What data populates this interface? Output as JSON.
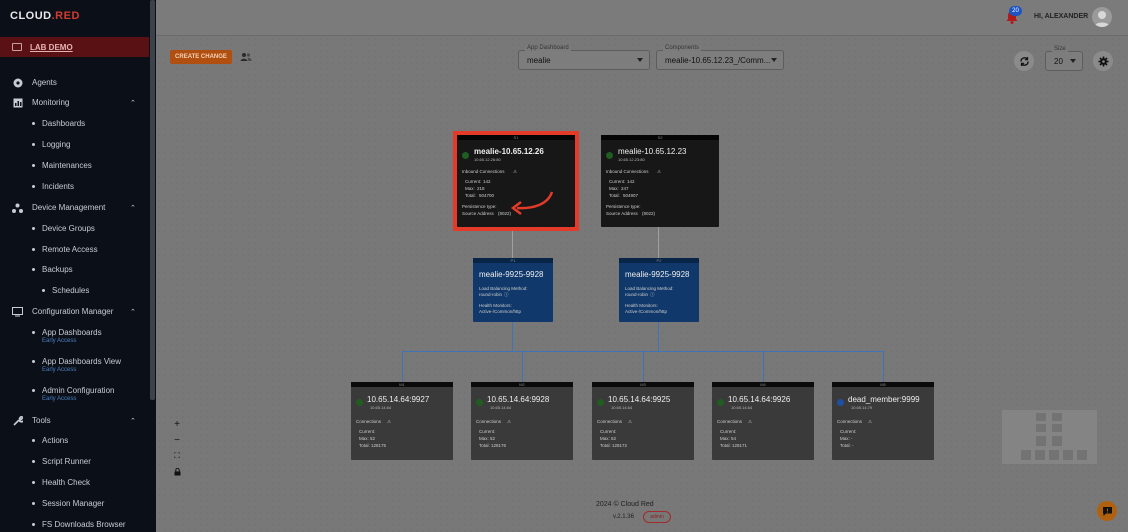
{
  "sidebar": {
    "logo_main": "CLOUD",
    "logo_accent": ".RED",
    "lab": "LAB DEMO",
    "items": [
      {
        "label": "Agents"
      },
      {
        "label": "Monitoring"
      },
      {
        "label": "Dashboards"
      },
      {
        "label": "Logging"
      },
      {
        "label": "Maintenances"
      },
      {
        "label": "Incidents"
      },
      {
        "label": "Device Management"
      },
      {
        "label": "Device Groups"
      },
      {
        "label": "Remote Access"
      },
      {
        "label": "Backups"
      },
      {
        "label": "Schedules"
      },
      {
        "label": "Configuration Manager"
      },
      {
        "label": "App Dashboards"
      },
      {
        "label": "App Dashboards View"
      },
      {
        "label": "Admin Configuration"
      },
      {
        "label": "Tools"
      },
      {
        "label": "Actions"
      },
      {
        "label": "Script Runner"
      },
      {
        "label": "Health Check"
      },
      {
        "label": "Session Manager"
      },
      {
        "label": "FS Downloads Browser"
      }
    ],
    "early_access": "Early Access"
  },
  "header": {
    "notifications": "20",
    "greeting": "HI, ALEXANDER"
  },
  "toolbar": {
    "create_change": "CREATE CHANGE",
    "app_dashboard_label": "App Dashboard",
    "app_dashboard_value": "mealie",
    "components_label": "Components",
    "components_value": "mealie-10.65.12.23_/Comm...",
    "size_label": "Size",
    "size_value": "20"
  },
  "nodes": {
    "top1": {
      "head": "S1",
      "title": "mealie-10.65.12.26",
      "sub": "10.65.12.26:80",
      "inbound": "Inbound Connections",
      "current_label": "Current:",
      "current_val": "142",
      "max_label": "Max:",
      "max_val": "218",
      "total_label": "Total:",
      "total_val": "504700",
      "persistence": "Persistence type:",
      "source": "Source Address",
      "source_link": "(9022)"
    },
    "top2": {
      "head": "S2",
      "title": "mealie-10.65.12.23",
      "sub": "10.65.12.23:80",
      "inbound": "Inbound Connections",
      "current_label": "Current:",
      "current_val": "142",
      "max_label": "Max:",
      "max_val": "247",
      "total_label": "Total:",
      "total_val": "504907",
      "persistence": "Persistence type:",
      "source": "Source Address",
      "source_link": "(9022)"
    },
    "mid1": {
      "head": "P1",
      "title": "mealie-9925-9928",
      "lb": "Load Balancing Method:",
      "lb_val": "round-robin",
      "hm": "Health Monitors:",
      "hm_val": "Active-/Common/http"
    },
    "mid2": {
      "head": "P2",
      "title": "mealie-9925-9928",
      "lb": "Load Balancing Method:",
      "lb_val": "round-robin",
      "hm": "Health Monitors:",
      "hm_val": "Active-/Common/http"
    },
    "members": [
      {
        "head": "M1",
        "title": "10.65.14.64:9927",
        "sub": "10.65.14.64",
        "conn": "Connections",
        "cur": "Current:",
        "max": "Max:  52",
        "total": "Total:  128175"
      },
      {
        "head": "M2",
        "title": "10.65.14.64:9928",
        "sub": "10.65.14.64",
        "conn": "Connections",
        "cur": "Current:",
        "max": "Max:  52",
        "total": "Total:  128176"
      },
      {
        "head": "M3",
        "title": "10.65.14.64:9925",
        "sub": "10.65.14.64",
        "conn": "Connections",
        "cur": "Current:",
        "max": "Max:  52",
        "total": "Total:  128172"
      },
      {
        "head": "M4",
        "title": "10.65.14.64:9926",
        "sub": "10.65.14.64",
        "conn": "Connections",
        "cur": "Current:",
        "max": "Max:  54",
        "total": "Total:  128171"
      },
      {
        "head": "M5",
        "title": "dead_member:9999",
        "sub": "10.65.14.79",
        "conn": "Connections",
        "cur": "Current:",
        "max": "Max:  -",
        "total": "Total:  -"
      }
    ]
  },
  "footer": {
    "copyright": "2024  © Cloud Red",
    "version": "v.2.1.36",
    "role": "admin"
  },
  "colors": {
    "accent_orange": "#b04f10",
    "highlight_red": "#e33a2a",
    "node_blue": "#10386a",
    "status_green": "#1f5d20"
  }
}
